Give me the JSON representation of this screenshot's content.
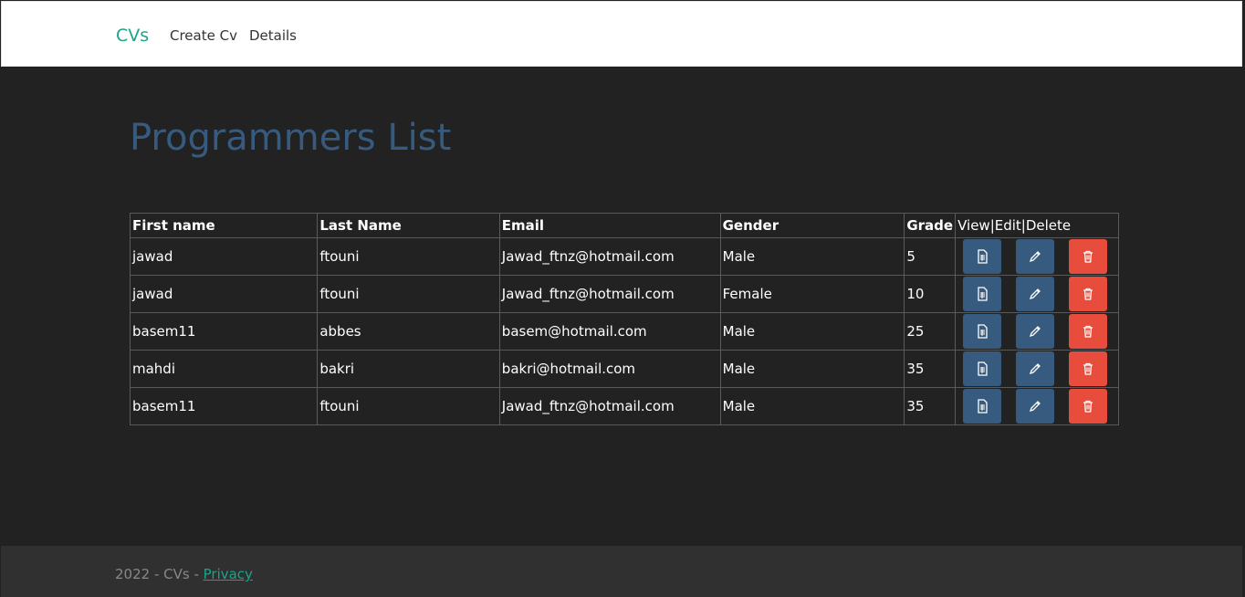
{
  "navbar": {
    "brand": "CVs",
    "links": [
      "Create Cv",
      "Details"
    ]
  },
  "page": {
    "title": "Programmers List"
  },
  "table": {
    "headers": [
      "First name",
      "Last Name",
      "Email",
      "Gender",
      "Grade",
      "View|Edit|Delete"
    ],
    "rows": [
      [
        "jawad",
        "ftouni",
        "Jawad_ftnz@hotmail.com",
        "Male",
        "5"
      ],
      [
        "jawad",
        "ftouni",
        "Jawad_ftnz@hotmail.com",
        "Female",
        "10"
      ],
      [
        "basem11",
        "abbes",
        "basem@hotmail.com",
        "Male",
        "25"
      ],
      [
        "mahdi",
        "bakri",
        "bakri@hotmail.com",
        "Male",
        "35"
      ],
      [
        "basem11",
        "ftouni",
        "Jawad_ftnz@hotmail.com",
        "Male",
        "35"
      ]
    ],
    "action_icons": [
      "file-icon",
      "pencil-icon",
      "trash-icon"
    ]
  },
  "footer": {
    "text": "2022 - CVs - ",
    "link": "Privacy"
  },
  "colors": {
    "background": "#222222",
    "brand": "#18a689",
    "title": "#375a7f",
    "view_edit_button": "#375a7f",
    "delete_button": "#e74c3c",
    "footer": "#303030"
  }
}
